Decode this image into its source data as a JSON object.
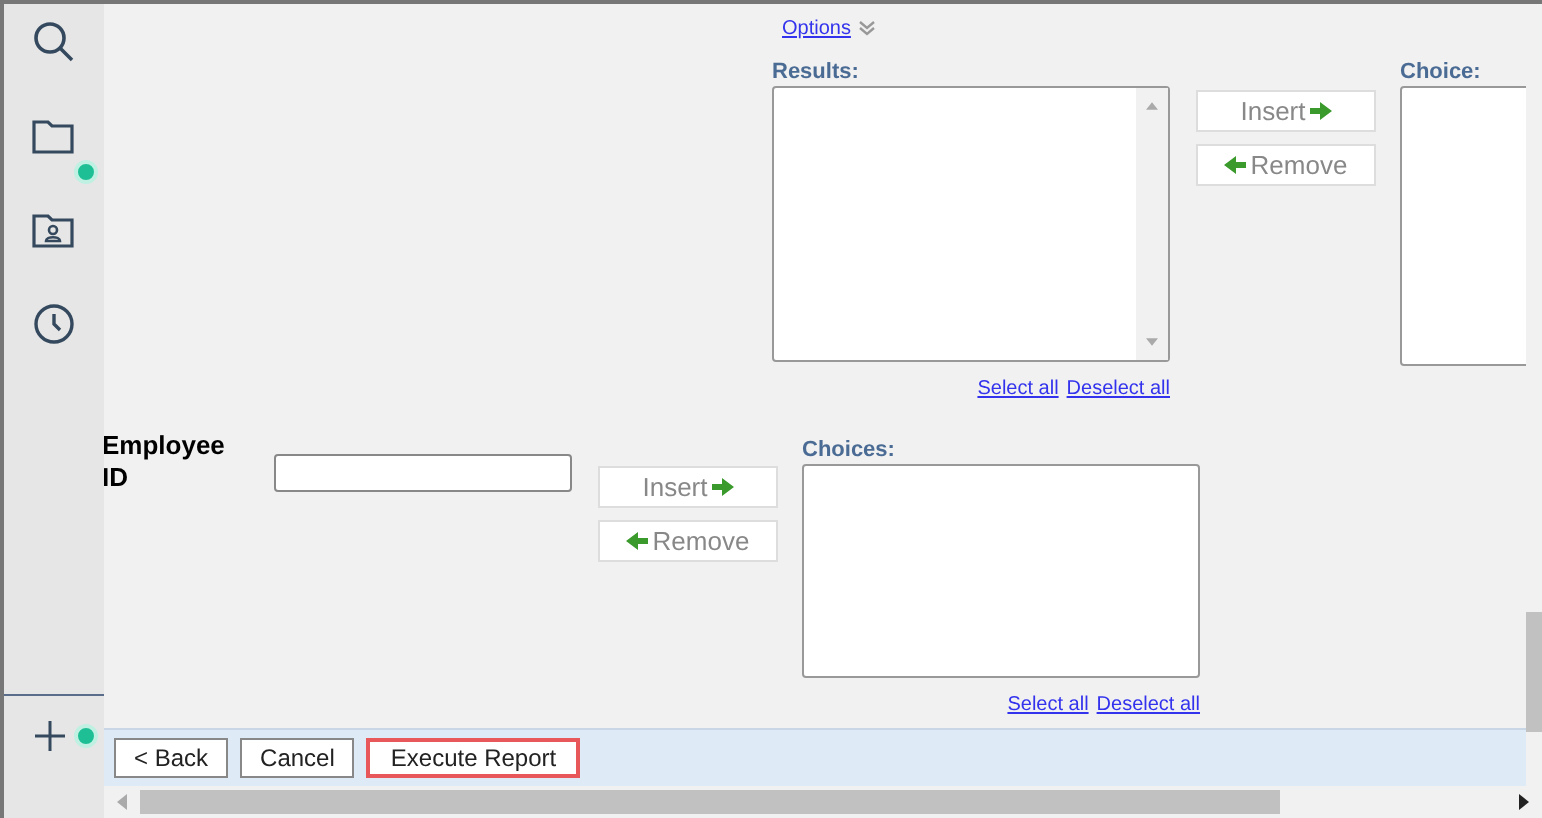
{
  "sidebar": {
    "items": [
      {
        "kind": "search",
        "badge": false
      },
      {
        "kind": "folder",
        "badge": true
      },
      {
        "kind": "contact-folder",
        "badge": false
      },
      {
        "kind": "clock",
        "badge": false
      }
    ],
    "bottom": {
      "kind": "plus",
      "badge": true
    }
  },
  "options_link": "Options",
  "results_section": {
    "results": {
      "label": "Results:",
      "links": [
        "Select all",
        "Deselect all"
      ]
    },
    "buttons": [
      {
        "kind": "insert",
        "label": "Insert"
      },
      {
        "kind": "remove",
        "label": "Remove"
      }
    ],
    "choice": {
      "label": "Choice:"
    }
  },
  "employee_section": {
    "label": "Employee ID",
    "buttons": [
      {
        "kind": "insert",
        "label": "Insert"
      },
      {
        "kind": "remove",
        "label": "Remove"
      }
    ],
    "choices": {
      "label": "Choices:",
      "links": [
        "Select all",
        "Deselect all"
      ]
    }
  },
  "footer": {
    "buttons": [
      {
        "label": "< Back",
        "selected": false
      },
      {
        "label": "Cancel",
        "selected": false
      },
      {
        "label": "Execute Report",
        "selected": true
      }
    ]
  }
}
